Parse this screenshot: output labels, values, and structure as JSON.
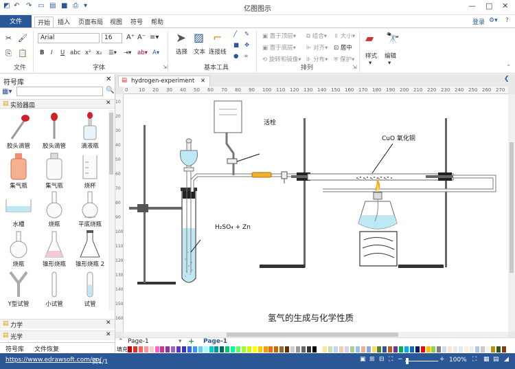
{
  "app": {
    "title": "亿图图示"
  },
  "quick_access": [
    "save-icon",
    "undo-icon",
    "redo-icon",
    "new-icon",
    "open-icon",
    "save-disk-icon",
    "print-icon"
  ],
  "window": {
    "minimize": "—",
    "restore": "□",
    "close": "✕"
  },
  "tabs": {
    "file": "文件",
    "items": [
      "开始",
      "插入",
      "页面布局",
      "视图",
      "符号",
      "帮助"
    ],
    "active": "开始",
    "login": "登录"
  },
  "ribbon": {
    "groups": {
      "file": "文件",
      "font": "字体",
      "basic_tools": "基本工具",
      "arrange": "排列"
    },
    "font_name": "Arial",
    "font_size": "16",
    "tools": {
      "select": "选择",
      "text": "文本",
      "connector": "连接线"
    },
    "arrange": {
      "to_front": "置于顶层",
      "to_back": "置于底层",
      "rotate_mirror": "旋转和镜像",
      "group": "组合",
      "align": "对齐",
      "distribute": "分布",
      "size": "大小",
      "center": "居中",
      "protect": "保护"
    },
    "style": "样式",
    "edit": "编辑"
  },
  "library": {
    "title": "符号库",
    "search_placeholder": "",
    "category": "实验器皿",
    "items": [
      "胶头滴管",
      "胶头滴管",
      "滴液瓶",
      "集气瓶",
      "集气瓶",
      "烧杯",
      "水槽",
      "烧瓶",
      "平底烧瓶",
      "烧瓶",
      "锥形烧瓶",
      "锥形烧瓶 2",
      "Y型试管",
      "小试管",
      "试管"
    ],
    "sections": [
      "力学",
      "光学"
    ],
    "bottom_tabs": [
      "符号库",
      "文件恢复"
    ]
  },
  "document": {
    "tab": "hydrogen-experiment",
    "ruler_h": [
      "0",
      "10",
      "20",
      "30",
      "40",
      "50",
      "60",
      "70",
      "80",
      "90",
      "100",
      "110",
      "120",
      "130",
      "140",
      "150",
      "160",
      "170",
      "180",
      "190",
      "200",
      "210",
      "220",
      "230",
      "240",
      "250",
      "260",
      "270",
      "280"
    ],
    "ruler_v": [
      "10",
      "20",
      "30",
      "40",
      "50",
      "60",
      "70",
      "80",
      "90",
      "100",
      "110",
      "120",
      "130",
      "140",
      "150",
      "160"
    ],
    "labels": {
      "stopcock": "活栓",
      "cuo": "CuO 氧化铜",
      "h2so4": "H₂SO₄ + Zn",
      "caption": "氢气的生成与化学性质"
    }
  },
  "pages": {
    "current": "Page-1",
    "tab": "Page-1"
  },
  "palette_label": "填充",
  "palette": [
    "#c00000",
    "#e03030",
    "#ff6060",
    "#ff9999",
    "#ffcccc",
    "#ff66cc",
    "#cc3399",
    "#993399",
    "#9966cc",
    "#6633cc",
    "#3333cc",
    "#3366ff",
    "#3399ff",
    "#66ccff",
    "#99ffff",
    "#00cccc",
    "#009999",
    "#006666",
    "#00cc66",
    "#00ff99",
    "#66ff66",
    "#99ff33",
    "#ccff00",
    "#ffff00",
    "#ffcc00",
    "#ff9900",
    "#ff6600",
    "#cc6600",
    "#996633",
    "#663300",
    "#cccccc",
    "#999999",
    "#666666",
    "#333333",
    "#000000",
    "#ffffff",
    "#ffe699",
    "#c6e0b4",
    "#bdd7ee",
    "#f8cbad",
    "#d9d2e9",
    "#a9d08e",
    "#9bc2e6",
    "#f4b084",
    "#8ea9db",
    "#ffd966",
    "#548235",
    "#2f5597",
    "#c55a11",
    "#7030a0",
    "#00b050",
    "#00b0f0",
    "#0070c0",
    "#002060",
    "#ff0000",
    "#ffc000",
    "#92d050",
    "#7f7f7f",
    "#d6dce5",
    "#fce4d6",
    "#e2efda",
    "#ddebf7",
    "#fff2cc",
    "#ededed",
    "#b4c6e7",
    "#c9c9c9",
    "#f2f2f2",
    "#bf9000",
    "#375623",
    "#833c0c"
  ],
  "status": {
    "url": "https://www.edrawsoft.com/cn/",
    "page": "页1/1",
    "zoom": "100%"
  },
  "colors": {
    "accent": "#2b5797",
    "liquid": "#bfe8f5",
    "flame": "#f5a623"
  }
}
